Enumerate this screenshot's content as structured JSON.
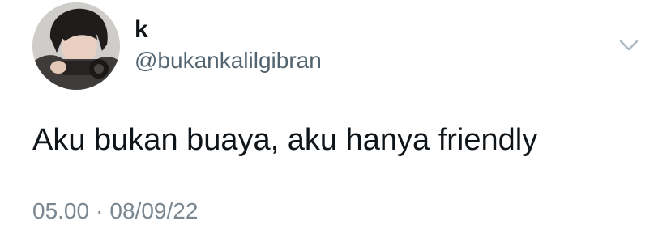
{
  "user": {
    "display_name": "k",
    "handle": "@bukankalilgibran",
    "avatar_icon": "profile-photo"
  },
  "tweet": {
    "text": "Aku bukan buaya, aku hanya friendly",
    "time": "05.00",
    "separator": "·",
    "date": "08/09/22"
  },
  "menu": {
    "icon": "chevron-down-icon"
  },
  "colors": {
    "text": "#0f1419",
    "secondary": "#536471",
    "caret": "#aab8c2"
  }
}
